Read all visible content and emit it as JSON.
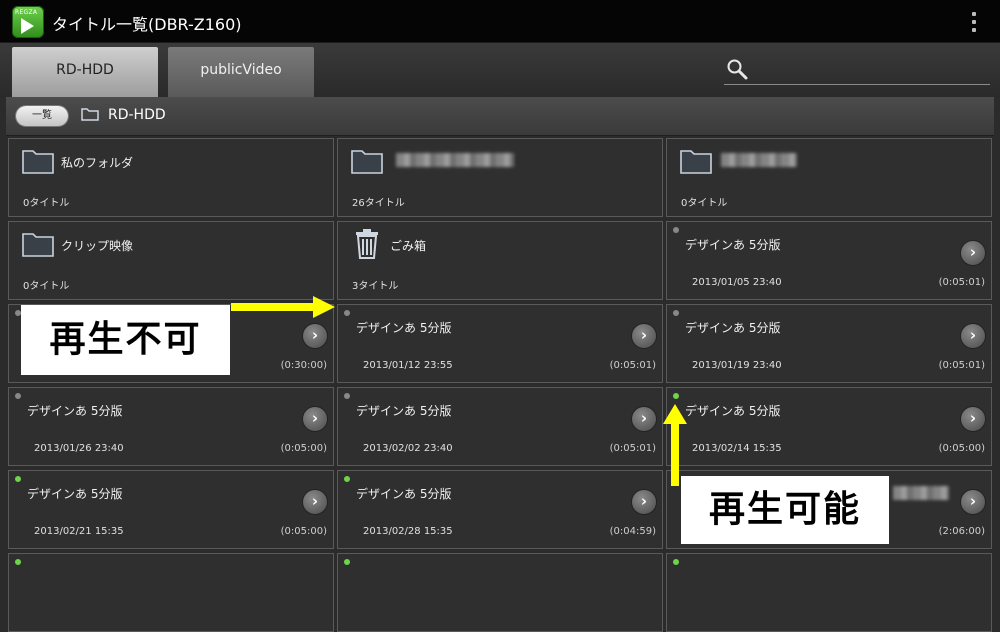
{
  "app": {
    "brand": "REGZA",
    "title": "タイトル一覧(DBR-Z160)"
  },
  "tabs": [
    {
      "label": "RD-HDD",
      "active": true
    },
    {
      "label": "publicVideo",
      "active": false
    }
  ],
  "search": {
    "value": "",
    "placeholder": ""
  },
  "breadcrumb": {
    "list_button": "一覧",
    "current": "RD-HDD"
  },
  "folders": [
    {
      "name": "私のフォルダ",
      "count": "0タイトル"
    },
    {
      "name": "",
      "count": "26タイトル"
    },
    {
      "name": "",
      "count": "0タイトル"
    },
    {
      "name": "クリップ映像",
      "count": "0タイトル"
    },
    {
      "name": "ごみ箱",
      "count": "3タイトル"
    }
  ],
  "titles": [
    {
      "name": "デザインあ 5分版",
      "date": "2013/01/05 23:40",
      "duration": "(0:05:01)",
      "playable": false
    },
    {
      "name": "",
      "date": "",
      "duration": "(0:30:00)",
      "playable": false
    },
    {
      "name": "デザインあ 5分版",
      "date": "2013/01/12 23:55",
      "duration": "(0:05:01)",
      "playable": false
    },
    {
      "name": "デザインあ 5分版",
      "date": "2013/01/19 23:40",
      "duration": "(0:05:01)",
      "playable": false
    },
    {
      "name": "デザインあ 5分版",
      "date": "2013/01/26 23:40",
      "duration": "(0:05:00)",
      "playable": false
    },
    {
      "name": "デザインあ 5分版",
      "date": "2013/02/02 23:40",
      "duration": "(0:05:01)",
      "playable": false
    },
    {
      "name": "デザインあ 5分版",
      "date": "2013/02/14 15:35",
      "duration": "(0:05:00)",
      "playable": true
    },
    {
      "name": "デザインあ 5分版",
      "date": "2013/02/21 15:35",
      "duration": "(0:05:00)",
      "playable": true
    },
    {
      "name": "デザインあ 5分版",
      "date": "2013/02/28 15:35",
      "duration": "(0:04:59)",
      "playable": true
    },
    {
      "name": "",
      "date": "",
      "duration": "(2:06:00)",
      "playable": true
    }
  ],
  "callouts": {
    "not_playable": "再生不可",
    "playable": "再生可能"
  },
  "colors": {
    "playable_dot": "#6fd44a",
    "unplayable_dot": "#888888",
    "annotation_arrow": "#ffff00"
  }
}
